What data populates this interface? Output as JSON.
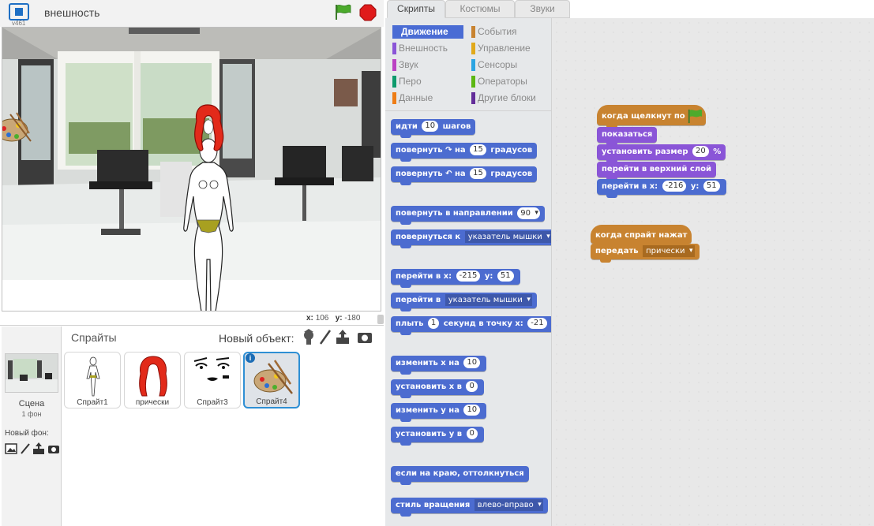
{
  "header": {
    "version": "v461",
    "project_title": "внешность"
  },
  "stage": {
    "coords": {
      "x_label": "x:",
      "x_value": "106",
      "y_label": "y:",
      "y_value": "-180"
    }
  },
  "sprite_pane": {
    "heading": "Спрайты",
    "new_object_label": "Новый объект:",
    "stage_label": "Сцена",
    "stage_sub": "1 фон",
    "new_backdrop_label": "Новый фон:",
    "sprites": [
      {
        "name": "Спрайт1",
        "selected": false
      },
      {
        "name": "прически",
        "selected": false
      },
      {
        "name": "Спрайт3",
        "selected": false
      },
      {
        "name": "Спрайт4",
        "selected": true
      }
    ],
    "info_badge": "i"
  },
  "tabs": [
    {
      "label": "Скрипты",
      "active": true
    },
    {
      "label": "Костюмы",
      "active": false
    },
    {
      "label": "Звуки",
      "active": false
    }
  ],
  "categories": [
    {
      "label": "Движение",
      "color": "#4a6cd4",
      "active": true
    },
    {
      "label": "Внешность",
      "color": "#8a55d7",
      "active": false
    },
    {
      "label": "Звук",
      "color": "#bb42c3",
      "active": false
    },
    {
      "label": "Перо",
      "color": "#0e9a6c",
      "active": false
    },
    {
      "label": "Данные",
      "color": "#ee7d16",
      "active": false
    },
    {
      "label": "События",
      "color": "#c88330",
      "active": false
    },
    {
      "label": "Управление",
      "color": "#e1a91a",
      "active": false
    },
    {
      "label": "Сенсоры",
      "color": "#2ca5e2",
      "active": false
    },
    {
      "label": "Операторы",
      "color": "#5cb712",
      "active": false
    },
    {
      "label": "Другие блоки",
      "color": "#632d99",
      "active": false
    }
  ],
  "palette": {
    "move": {
      "pre": "идти",
      "val": "10",
      "post": "шагов"
    },
    "turn_right": {
      "pre": "повернуть",
      "mid": "на",
      "val": "15",
      "post": "градусов"
    },
    "turn_left": {
      "pre": "повернуть",
      "mid": "на",
      "val": "15",
      "post": "градусов"
    },
    "point_dir": {
      "pre": "повернуть в направлении",
      "val": "90"
    },
    "point_towards": {
      "pre": "повернуться к",
      "val": "указатель мышки"
    },
    "goto_xy": {
      "pre": "перейти в x:",
      "x": "-215",
      "ylabel": "y:",
      "y": "51"
    },
    "goto": {
      "pre": "перейти в",
      "val": "указатель мышки"
    },
    "glide": {
      "pre": "плыть",
      "val": "1",
      "mid": "секунд в точку x:",
      "x": "-21"
    },
    "change_x": {
      "pre": "изменить х на",
      "val": "10"
    },
    "set_x": {
      "pre": "установить х в",
      "val": "0"
    },
    "change_y": {
      "pre": "изменить у на",
      "val": "10"
    },
    "set_y": {
      "pre": "установить у в",
      "val": "0"
    },
    "bounce": {
      "label": "если на краю, оттолкнуться"
    },
    "rotation_style": {
      "pre": "стиль вращения",
      "val": "влево-вправо"
    }
  },
  "scripts": {
    "script1": {
      "hat": "когда щелкнут по",
      "show": "показаться",
      "set_size": {
        "pre": "установить размер",
        "val": "20",
        "post": "%"
      },
      "front": "перейти в верхний слой",
      "goto_xy": {
        "pre": "перейти в x:",
        "x": "-216",
        "ylabel": "y:",
        "y": "51"
      }
    },
    "script2": {
      "hat": "когда спрайт нажат",
      "broadcast": {
        "pre": "передать",
        "val": "прически"
      }
    }
  }
}
